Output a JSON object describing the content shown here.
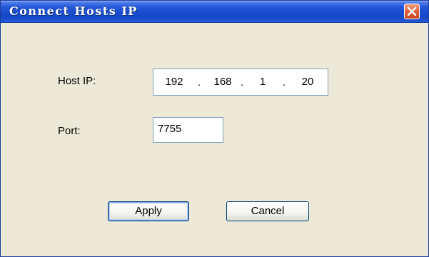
{
  "window": {
    "title": "Connect Hosts IP",
    "close_icon": "close-icon"
  },
  "form": {
    "host_ip_label": "Host IP:",
    "host_ip": {
      "octet1": "192",
      "octet2": "168",
      "octet3": "1",
      "octet4": "20",
      "separator": "."
    },
    "port_label": "Port:",
    "port_value": "7755"
  },
  "buttons": {
    "apply_label": "Apply",
    "cancel_label": "Cancel"
  },
  "colors": {
    "titlebar": "#1448c8",
    "background": "#ece9d8",
    "close_button": "#e0643f"
  }
}
